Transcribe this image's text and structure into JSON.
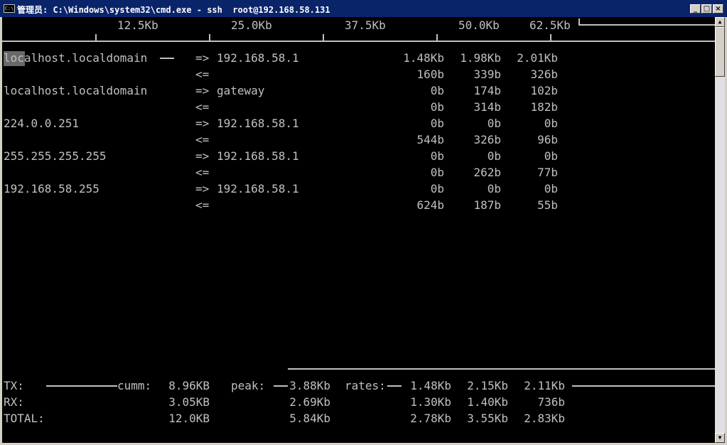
{
  "window": {
    "title": "管理员: C:\\Windows\\system32\\cmd.exe - ssh  root@192.168.58.131",
    "minimize_glyph": "_",
    "maximize_glyph": "□",
    "close_glyph": "×"
  },
  "scale": [
    "12.5Kb",
    "25.0Kb",
    "37.5Kb",
    "50.0Kb",
    "62.5Kb"
  ],
  "rows": [
    {
      "host": "localhost.localdomain",
      "dir_out": "=>",
      "peer": "192.168.58.1",
      "dir_in": "<=",
      "out_rates": [
        "1.48Kb",
        "1.98Kb",
        "2.01Kb"
      ],
      "in_rates": [
        "160b",
        "339b",
        "326b"
      ]
    },
    {
      "host": "localhost.localdomain",
      "dir_out": "=>",
      "peer": "gateway",
      "dir_in": "<=",
      "out_rates": [
        "0b",
        "174b",
        "102b"
      ],
      "in_rates": [
        "0b",
        "314b",
        "182b"
      ]
    },
    {
      "host": "224.0.0.251",
      "dir_out": "=>",
      "peer": "192.168.58.1",
      "dir_in": "<=",
      "out_rates": [
        "0b",
        "0b",
        "0b"
      ],
      "in_rates": [
        "544b",
        "326b",
        "96b"
      ]
    },
    {
      "host": "255.255.255.255",
      "dir_out": "=>",
      "peer": "192.168.58.1",
      "dir_in": "<=",
      "out_rates": [
        "0b",
        "0b",
        "0b"
      ],
      "in_rates": [
        "0b",
        "262b",
        "77b"
      ]
    },
    {
      "host": "192.168.58.255",
      "dir_out": "=>",
      "peer": "192.168.58.1",
      "dir_in": "<=",
      "out_rates": [
        "0b",
        "0b",
        "0b"
      ],
      "in_rates": [
        "624b",
        "187b",
        "55b"
      ]
    }
  ],
  "footer": {
    "tx_label": "TX:",
    "rx_label": "RX:",
    "total_label": "TOTAL:",
    "cumm_label": "cumm:",
    "peak_label": "peak:",
    "rates_label": "rates:",
    "tx": {
      "cumm": "8.96KB",
      "peak": "3.88Kb",
      "rates": [
        "1.48Kb",
        "2.15Kb",
        "2.11Kb"
      ]
    },
    "rx": {
      "cumm": "3.05KB",
      "peak": "2.69Kb",
      "rates": [
        "1.30Kb",
        "1.40Kb",
        "736b"
      ]
    },
    "total": {
      "cumm": "12.0KB",
      "peak": "5.84Kb",
      "rates": [
        "2.78Kb",
        "3.55Kb",
        "2.83Kb"
      ]
    }
  }
}
